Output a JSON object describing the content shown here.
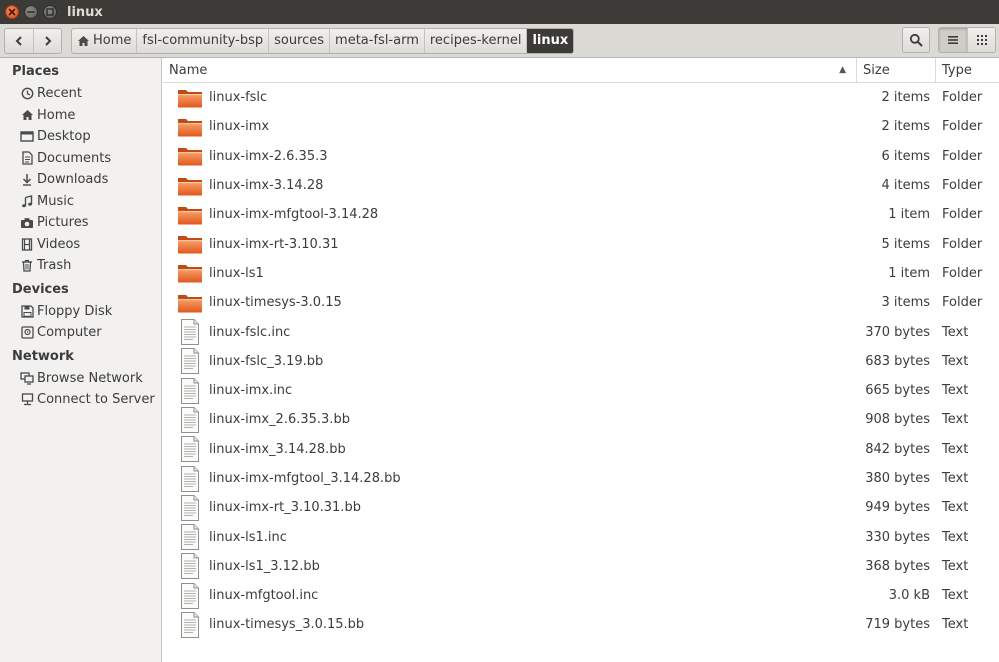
{
  "window": {
    "title": "linux"
  },
  "breadcrumb": [
    "Home",
    "fsl-community-bsp",
    "sources",
    "meta-fsl-arm",
    "recipes-kernel",
    "linux"
  ],
  "sidebar": {
    "places_header": "Places",
    "places": [
      {
        "label": "Recent",
        "icon": "clock-icon"
      },
      {
        "label": "Home",
        "icon": "home-icon"
      },
      {
        "label": "Desktop",
        "icon": "desktop-icon"
      },
      {
        "label": "Documents",
        "icon": "document-icon"
      },
      {
        "label": "Downloads",
        "icon": "download-icon"
      },
      {
        "label": "Music",
        "icon": "music-icon"
      },
      {
        "label": "Pictures",
        "icon": "camera-icon"
      },
      {
        "label": "Videos",
        "icon": "film-icon"
      },
      {
        "label": "Trash",
        "icon": "trash-icon"
      }
    ],
    "devices_header": "Devices",
    "devices": [
      {
        "label": "Floppy Disk",
        "icon": "floppy-icon"
      },
      {
        "label": "Computer",
        "icon": "harddisk-icon"
      }
    ],
    "network_header": "Network",
    "network": [
      {
        "label": "Browse Network",
        "icon": "network-icon"
      },
      {
        "label": "Connect to Server",
        "icon": "server-icon"
      }
    ]
  },
  "columns": {
    "name": "Name",
    "size": "Size",
    "type": "Type"
  },
  "files": [
    {
      "name": "linux-fslc",
      "size": "2 items",
      "type": "Folder",
      "kind": "folder"
    },
    {
      "name": "linux-imx",
      "size": "2 items",
      "type": "Folder",
      "kind": "folder"
    },
    {
      "name": "linux-imx-2.6.35.3",
      "size": "6 items",
      "type": "Folder",
      "kind": "folder"
    },
    {
      "name": "linux-imx-3.14.28",
      "size": "4 items",
      "type": "Folder",
      "kind": "folder"
    },
    {
      "name": "linux-imx-mfgtool-3.14.28",
      "size": "1 item",
      "type": "Folder",
      "kind": "folder"
    },
    {
      "name": "linux-imx-rt-3.10.31",
      "size": "5 items",
      "type": "Folder",
      "kind": "folder"
    },
    {
      "name": "linux-ls1",
      "size": "1 item",
      "type": "Folder",
      "kind": "folder"
    },
    {
      "name": "linux-timesys-3.0.15",
      "size": "3 items",
      "type": "Folder",
      "kind": "folder"
    },
    {
      "name": "linux-fslc.inc",
      "size": "370 bytes",
      "type": "Text",
      "kind": "text"
    },
    {
      "name": "linux-fslc_3.19.bb",
      "size": "683 bytes",
      "type": "Text",
      "kind": "text"
    },
    {
      "name": "linux-imx.inc",
      "size": "665 bytes",
      "type": "Text",
      "kind": "text"
    },
    {
      "name": "linux-imx_2.6.35.3.bb",
      "size": "908 bytes",
      "type": "Text",
      "kind": "text"
    },
    {
      "name": "linux-imx_3.14.28.bb",
      "size": "842 bytes",
      "type": "Text",
      "kind": "text"
    },
    {
      "name": "linux-imx-mfgtool_3.14.28.bb",
      "size": "380 bytes",
      "type": "Text",
      "kind": "text"
    },
    {
      "name": "linux-imx-rt_3.10.31.bb",
      "size": "949 bytes",
      "type": "Text",
      "kind": "text"
    },
    {
      "name": "linux-ls1.inc",
      "size": "330 bytes",
      "type": "Text",
      "kind": "text"
    },
    {
      "name": "linux-ls1_3.12.bb",
      "size": "368 bytes",
      "type": "Text",
      "kind": "text"
    },
    {
      "name": "linux-mfgtool.inc",
      "size": "3.0 kB",
      "type": "Text",
      "kind": "text"
    },
    {
      "name": "linux-timesys_3.0.15.bb",
      "size": "719 bytes",
      "type": "Text",
      "kind": "text"
    }
  ]
}
